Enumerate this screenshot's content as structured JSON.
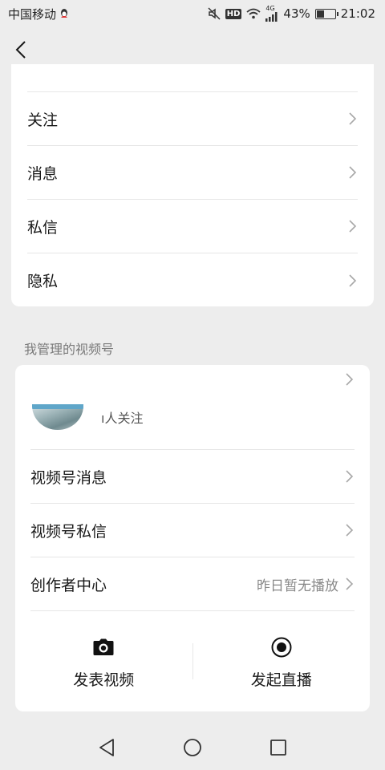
{
  "status_bar": {
    "carrier": "中国移动",
    "network": "4G",
    "hd_label": "HD",
    "battery_percent": "43%",
    "battery_level": 0.43,
    "time": "21:02",
    "icons": [
      "qq-icon",
      "mute-icon",
      "hd-icon",
      "wifi-icon",
      "signal-icon",
      "battery-icon"
    ]
  },
  "header": {
    "back_icon": "back-chevron-icon"
  },
  "settings_list": {
    "items": [
      {
        "label": "关注"
      },
      {
        "label": "消息"
      },
      {
        "label": "私信"
      },
      {
        "label": "隐私"
      }
    ]
  },
  "channels_section": {
    "title": "我管理的视频号",
    "account": {
      "followers_text": "ı人关注"
    },
    "items": [
      {
        "label": "视频号消息",
        "value": ""
      },
      {
        "label": "视频号私信",
        "value": ""
      },
      {
        "label": "创作者中心",
        "value": "昨日暂无播放"
      }
    ],
    "actions": [
      {
        "label": "发表视频",
        "icon": "camera-icon"
      },
      {
        "label": "发起直播",
        "icon": "live-record-icon"
      }
    ]
  },
  "nav_bar": {
    "icons": [
      "nav-back-icon",
      "nav-home-icon",
      "nav-recents-icon"
    ]
  },
  "colors": {
    "background": "#ededed",
    "card": "#ffffff",
    "text_primary": "#191919",
    "text_secondary": "#888888",
    "divider": "#e6e6e6"
  }
}
